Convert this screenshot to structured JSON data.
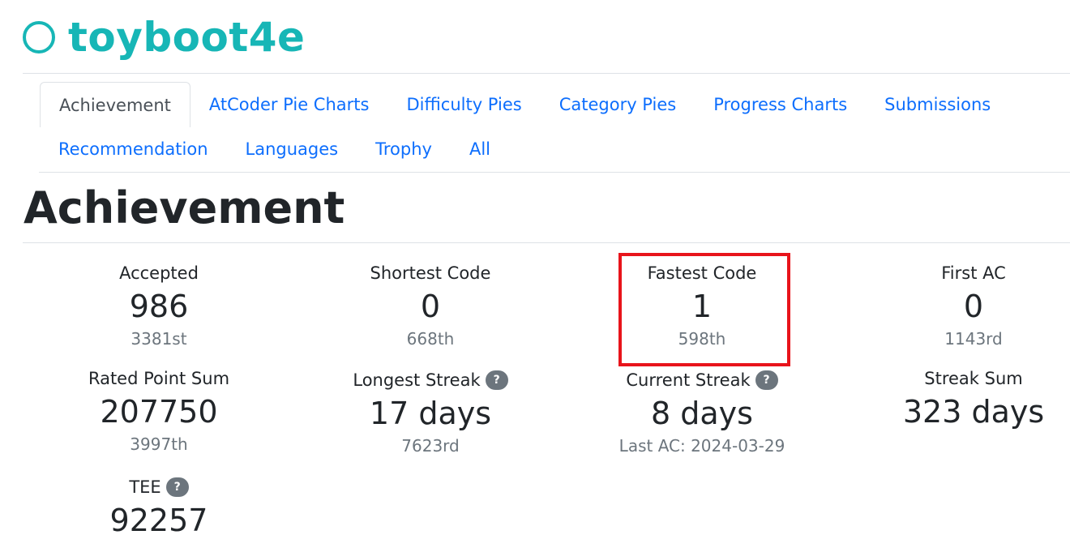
{
  "header": {
    "username": "toyboot4e"
  },
  "tabs": [
    {
      "label": "Achievement",
      "active": true
    },
    {
      "label": "AtCoder Pie Charts"
    },
    {
      "label": "Difficulty Pies"
    },
    {
      "label": "Category Pies"
    },
    {
      "label": "Progress Charts"
    },
    {
      "label": "Submissions"
    },
    {
      "label": "Recommendation"
    },
    {
      "label": "Languages"
    },
    {
      "label": "Trophy"
    },
    {
      "label": "All"
    }
  ],
  "page_title": "Achievement",
  "stats": {
    "accepted": {
      "label": "Accepted",
      "value": "986",
      "rank": "3381st"
    },
    "shortest_code": {
      "label": "Shortest Code",
      "value": "0",
      "rank": "668th"
    },
    "fastest_code": {
      "label": "Fastest Code",
      "value": "1",
      "rank": "598th"
    },
    "first_ac": {
      "label": "First AC",
      "value": "0",
      "rank": "1143rd"
    },
    "rated_point_sum": {
      "label": "Rated Point Sum",
      "value": "207750",
      "rank": "3997th"
    },
    "longest_streak": {
      "label": "Longest Streak",
      "value": "17 days",
      "rank": "7623rd"
    },
    "current_streak": {
      "label": "Current Streak",
      "value": "8 days",
      "last_ac": "Last AC: 2024-03-29"
    },
    "streak_sum": {
      "label": "Streak Sum",
      "value": "323 days"
    },
    "tee": {
      "label": "TEE",
      "value": "92257"
    }
  },
  "help_icon_text": "?",
  "colors": {
    "accent": "#17b6b6",
    "link": "#0d6efd",
    "highlight": "#e8141b"
  }
}
